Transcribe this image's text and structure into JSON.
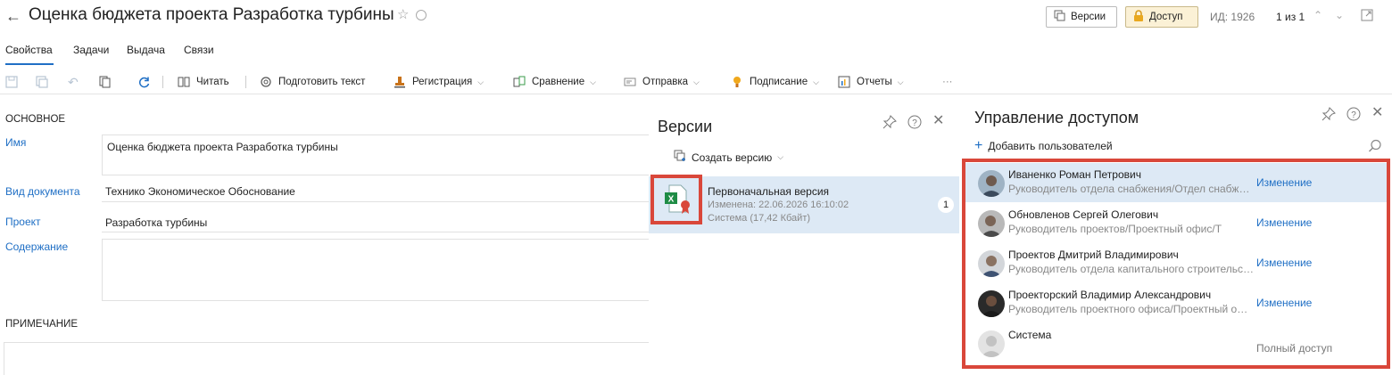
{
  "header": {
    "title": "Оценка бюджета проекта Разработка турбины",
    "versions_label": "Версии",
    "access_label": "Доступ",
    "id_text": "ИД: 1926",
    "pager_text": "1 из 1"
  },
  "tabs": [
    {
      "label": "Свойства"
    },
    {
      "label": "Задачи"
    },
    {
      "label": "Выдача"
    },
    {
      "label": "Связи"
    }
  ],
  "toolbar": {
    "read": "Читать",
    "prepare_text": "Подготовить текст",
    "registration": "Регистрация",
    "compare": "Сравнение",
    "send": "Отправка",
    "signing": "Подписание",
    "reports": "Отчеты",
    "more": "···"
  },
  "form": {
    "section_main": "ОСНОВНОЕ",
    "name_label": "Имя",
    "name_value": "Оценка бюджета проекта Разработка турбины",
    "doc_type_label": "Вид документа",
    "doc_type_value": "Технико Экономическое Обоснование",
    "project_label": "Проект",
    "project_value": "Разработка турбины",
    "content_label": "Содержание",
    "section_note": "ПРИМЕЧАНИЕ"
  },
  "versions_panel": {
    "title": "Версии",
    "create_label": "Создать версию",
    "version": {
      "name": "Первоначальная версия",
      "modified": "Изменена: 22.06.2026 16:10:02",
      "author": "Система (17,42 Кбайт)",
      "number": "1"
    }
  },
  "access_panel": {
    "title": "Управление доступом",
    "add_label": "Добавить пользователей",
    "users": [
      {
        "name": "Иваненко Роман Петрович",
        "role": "Руководитель отдела снабжения/Отдел снабжения",
        "access": "Изменение"
      },
      {
        "name": "Обновленов Сергей Олегович",
        "role": "Руководитель проектов/Проектный офис/Т",
        "access": "Изменение"
      },
      {
        "name": "Проектов Дмитрий Владимирович",
        "role": "Руководитель отдела капитального строительства",
        "access": "Изменение"
      },
      {
        "name": "Проекторский Владимир Александрович",
        "role": "Руководитель проектного офиса/Проектный офис",
        "access": "Изменение"
      },
      {
        "name": "Система",
        "role": "",
        "access": "Полный доступ"
      }
    ]
  },
  "colors": {
    "accent": "#1f6fc5",
    "selection": "#dde9f5",
    "highlight_border": "#d9473a",
    "access_button_bg": "#fbf1d6"
  }
}
